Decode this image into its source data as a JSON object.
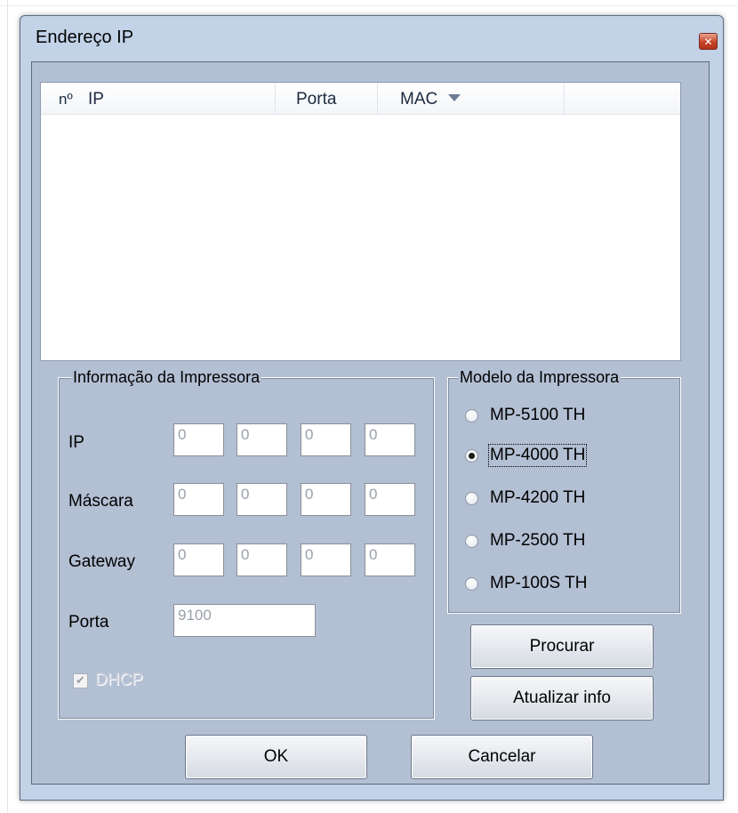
{
  "window": {
    "title": "Endereço IP",
    "close_icon": "close-icon (×)"
  },
  "list": {
    "columns": [
      "nº",
      "IP",
      "Porta",
      "MAC"
    ],
    "sort_icon": "sort-down-arrow-icon",
    "rows": []
  },
  "printer_info": {
    "legend": "Informação da Impressora",
    "ip": {
      "label": "IP",
      "octets": [
        "0",
        "0",
        "0",
        "0"
      ]
    },
    "mask": {
      "label": "Máscara",
      "octets": [
        "0",
        "0",
        "0",
        "0"
      ]
    },
    "gateway": {
      "label": "Gateway",
      "octets": [
        "0",
        "0",
        "0",
        "0"
      ]
    },
    "port": {
      "label": "Porta",
      "value": "9100"
    },
    "dhcp": {
      "label": "DHCP",
      "checked": true,
      "enabled": false
    }
  },
  "printer_model": {
    "legend": "Modelo da Impressora",
    "options": [
      "MP-5100 TH",
      "MP-4000 TH",
      "MP-4200 TH",
      "MP-2500 TH",
      "MP-100S TH"
    ],
    "selected": "MP-4000 TH"
  },
  "buttons": {
    "search": "Procurar",
    "refresh": "Atualizar info",
    "ok": "OK",
    "cancel": "Cancelar"
  }
}
